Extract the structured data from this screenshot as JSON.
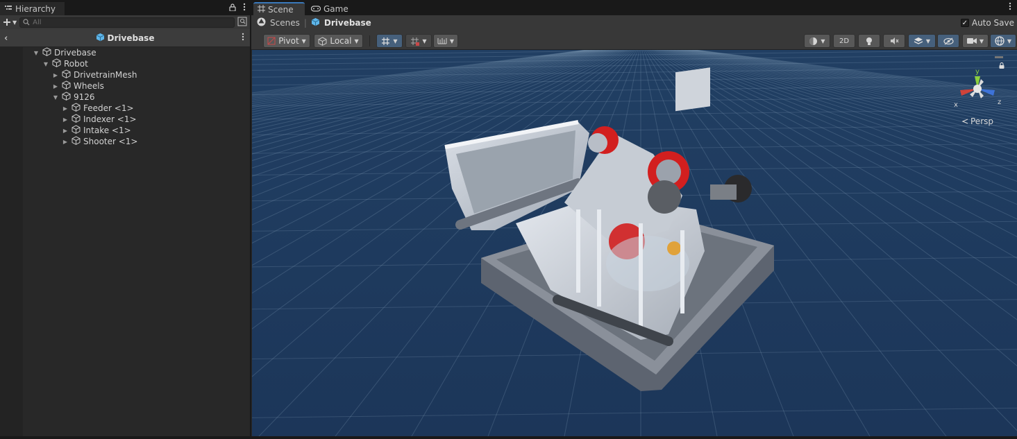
{
  "hierarchy": {
    "tab_label": "Hierarchy",
    "search_placeholder": "All",
    "prefab_title": "Drivebase",
    "tree": [
      {
        "label": "Drivebase",
        "depth": 0,
        "expanded": true
      },
      {
        "label": "Robot",
        "depth": 1,
        "expanded": true
      },
      {
        "label": "DrivetrainMesh",
        "depth": 2,
        "expanded": false
      },
      {
        "label": "Wheels",
        "depth": 2,
        "expanded": false
      },
      {
        "label": "9126",
        "depth": 2,
        "expanded": true
      },
      {
        "label": "Feeder <1>",
        "depth": 3,
        "expanded": false
      },
      {
        "label": "Indexer <1>",
        "depth": 3,
        "expanded": false
      },
      {
        "label": "Intake <1>",
        "depth": 3,
        "expanded": false
      },
      {
        "label": "Shooter <1>",
        "depth": 3,
        "expanded": false
      }
    ]
  },
  "scene": {
    "tab_scene": "Scene",
    "tab_game": "Game",
    "breadcrumb_scenes": "Scenes",
    "breadcrumb_prefab": "Drivebase",
    "autosave_label": "Auto Save",
    "autosave_checked": true,
    "pivot_label": "Pivot",
    "local_label": "Local",
    "mode_2d_label": "2D",
    "persp_label": "Persp",
    "gizmo_axes": {
      "x": "x",
      "y": "y",
      "z": "z"
    }
  },
  "colors": {
    "accent": "#3a79bb",
    "viewport_bg": "#1e3a5f",
    "axis_x": "#d0433a",
    "axis_y": "#8ccf3e",
    "axis_z": "#3e73d8",
    "robot_red": "#d21f1f"
  }
}
